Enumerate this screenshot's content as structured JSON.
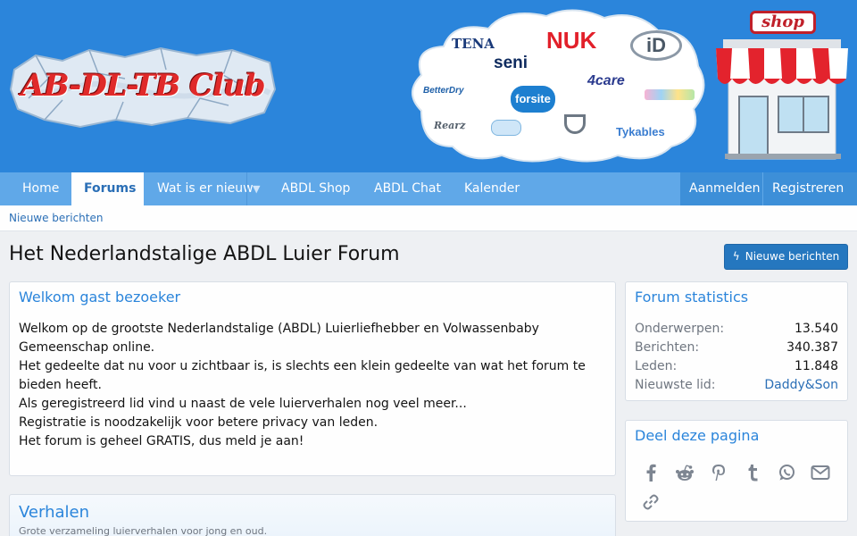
{
  "header": {
    "logo_text": "AB-DL-TB Club",
    "brands": [
      "TENA",
      "seni",
      "NUK",
      "iD",
      "BetterDry",
      "forsite",
      "4care",
      "Rearz",
      "Tykables"
    ],
    "shop_sign": "shop"
  },
  "nav": {
    "items": [
      {
        "label": "Home"
      },
      {
        "label": "Forums"
      },
      {
        "label": "Wat is er nieuw"
      },
      {
        "label": "ABDL Shop"
      },
      {
        "label": "ABDL Chat"
      },
      {
        "label": "Kalender"
      }
    ],
    "login": "Aanmelden",
    "register": "Registreren"
  },
  "subnav": {
    "new_posts": "Nieuwe berichten"
  },
  "page": {
    "title": "Het Nederlandstalige ABDL Luier Forum",
    "new_posts_button": "Nieuwe berichten"
  },
  "welcome": {
    "title": "Welkom gast bezoeker",
    "lines": [
      "Welkom op de grootste Nederlandstalige (ABDL) Luierliefhebber en Volwassenbaby Gemeenschap online.",
      "Het gedeelte dat nu voor u zichtbaar is, is slechts een klein gedeelte van wat het forum te bieden heeft.",
      "Als geregistreerd lid vind u naast de vele luierverhalen nog veel meer...",
      "Registratie is noodzakelijk voor betere privacy van leden.",
      "Het forum is geheel GRATIS, dus meld je aan!"
    ]
  },
  "stats": {
    "title": "Forum statistics",
    "rows": [
      {
        "label": "Onderwerpen:",
        "value": "13.540"
      },
      {
        "label": "Berichten:",
        "value": "340.387"
      },
      {
        "label": "Leden:",
        "value": "11.848"
      },
      {
        "label": "Nieuwste lid:",
        "value": "Daddy&Son"
      }
    ]
  },
  "share": {
    "title": "Deel deze pagina",
    "icons": [
      "facebook-icon",
      "reddit-icon",
      "pinterest-icon",
      "tumblr-icon",
      "whatsapp-icon",
      "email-icon",
      "link-icon"
    ]
  },
  "verhalen": {
    "title": "Verhalen",
    "description": "Grote verzameling luierverhalen voor jong en oud."
  },
  "colors": {
    "header_bg": "#2b85db",
    "nav_bg": "#60a8e8",
    "accent": "#2b85db",
    "button": "#2577bf"
  }
}
